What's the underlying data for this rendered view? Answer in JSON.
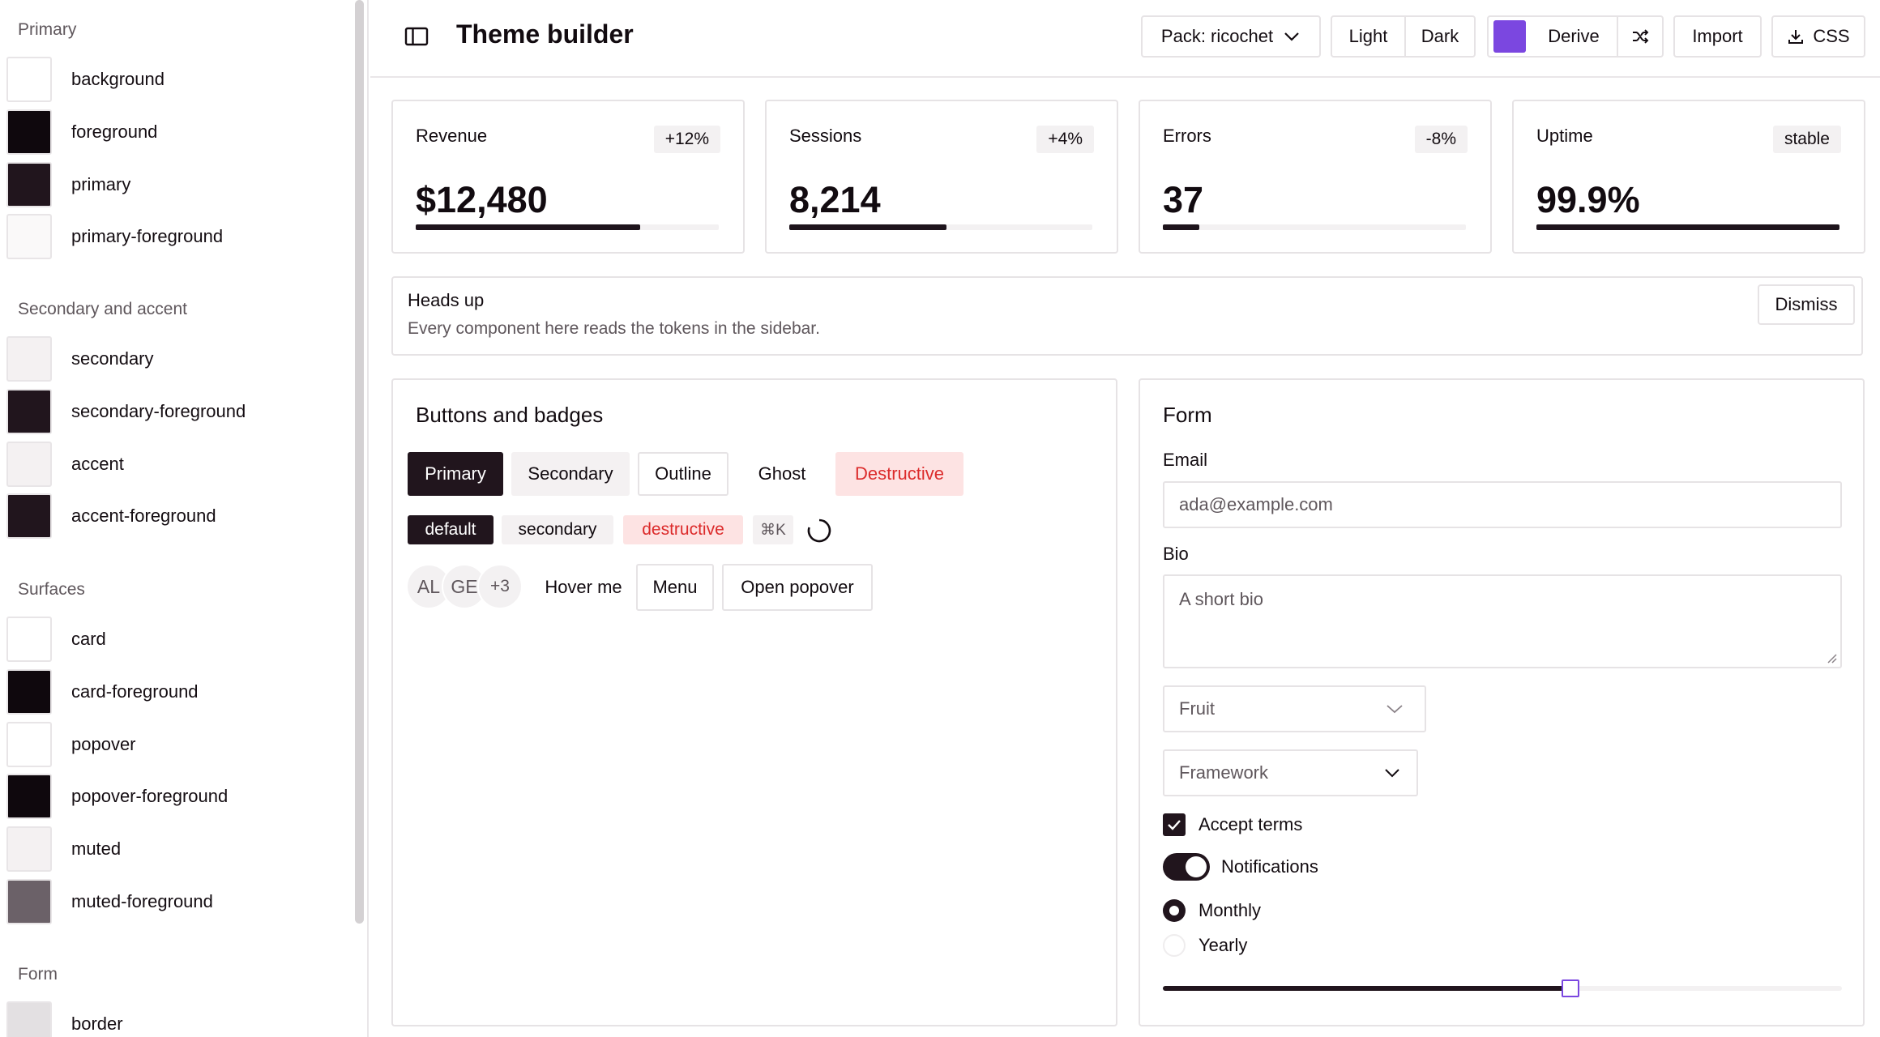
{
  "sidebar": {
    "groups": [
      {
        "title": "Primary",
        "tokens": [
          {
            "label": "background",
            "color": "#ffffff"
          },
          {
            "label": "foreground",
            "color": "#0f080d"
          },
          {
            "label": "primary",
            "color": "#21151d"
          },
          {
            "label": "primary-foreground",
            "color": "#faf9f9"
          }
        ]
      },
      {
        "title": "Secondary and accent",
        "tokens": [
          {
            "label": "secondary",
            "color": "#f4f1f2"
          },
          {
            "label": "secondary-foreground",
            "color": "#21151d"
          },
          {
            "label": "accent",
            "color": "#f4f1f2"
          },
          {
            "label": "accent-foreground",
            "color": "#21151d"
          }
        ]
      },
      {
        "title": "Surfaces",
        "tokens": [
          {
            "label": "card",
            "color": "#ffffff"
          },
          {
            "label": "card-foreground",
            "color": "#0f080d"
          },
          {
            "label": "popover",
            "color": "#ffffff"
          },
          {
            "label": "popover-foreground",
            "color": "#0f080d"
          },
          {
            "label": "muted",
            "color": "#f4f1f2"
          },
          {
            "label": "muted-foreground",
            "color": "#6b6168"
          }
        ]
      },
      {
        "title": "Form",
        "tokens": [
          {
            "label": "border",
            "color": "#e3e0e2"
          }
        ]
      }
    ]
  },
  "header": {
    "title": "Theme builder",
    "pack_label": "Pack: ricochet",
    "light_label": "Light",
    "dark_label": "Dark",
    "accent_color": "#7b47e0",
    "derive_label": "Derive",
    "import_label": "Import",
    "css_label": "CSS",
    "icons": [
      "sidebar-toggle-icon",
      "chevron-down-icon",
      "shuffle-icon",
      "download-icon"
    ]
  },
  "stats": [
    {
      "label": "Revenue",
      "delta": "+12%",
      "value": "$12,480",
      "progress": 0.74
    },
    {
      "label": "Sessions",
      "delta": "+4%",
      "value": "8,214",
      "progress": 0.52
    },
    {
      "label": "Errors",
      "delta": "-8%",
      "value": "37",
      "progress": 0.12
    },
    {
      "label": "Uptime",
      "delta": "stable",
      "value": "99.9%",
      "progress": 1.0
    }
  ],
  "alert": {
    "title": "Heads up",
    "message": "Every component here reads the tokens in the sidebar.",
    "dismiss_label": "Dismiss"
  },
  "buttons_panel": {
    "title": "Buttons and badges",
    "buttons": {
      "primary": "Primary",
      "secondary": "Secondary",
      "outline": "Outline",
      "ghost": "Ghost",
      "destructive": "Destructive"
    },
    "badges": {
      "default": "default",
      "secondary": "secondary",
      "destructive": "destructive",
      "kbd": "⌘K"
    },
    "avatars": [
      "AL",
      "GE",
      "+3"
    ],
    "hover_label": "Hover me",
    "menu_label": "Menu",
    "popover_label": "Open popover"
  },
  "form_panel": {
    "title": "Form",
    "email_label": "Email",
    "email_placeholder": "ada@example.com",
    "bio_label": "Bio",
    "bio_placeholder": "A short bio",
    "fruit_placeholder": "Fruit",
    "framework_placeholder": "Framework",
    "accept_terms_label": "Accept terms",
    "accept_terms_checked": true,
    "notifications_label": "Notifications",
    "notifications_on": true,
    "radio_options": [
      "Monthly",
      "Yearly"
    ],
    "radio_selected": "Monthly",
    "slider_value": 0.6
  },
  "colors": {
    "primary": "#21151d",
    "destructive_text": "#dc2b2b",
    "destructive_bg": "#fde3e3",
    "muted_bg": "#f3f1f2",
    "border": "#e6e3e5",
    "accent": "#7b47e0"
  }
}
